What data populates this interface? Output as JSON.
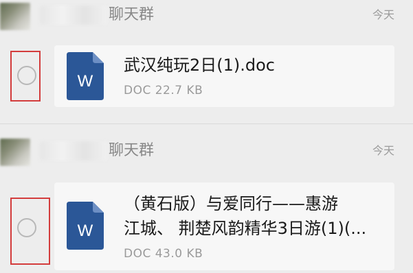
{
  "messages": [
    {
      "group_name": "聊天群",
      "time": "今天",
      "selected": false,
      "file": {
        "title_line1": "武汉纯玩2日(1).doc",
        "title_line2": "",
        "type": "DOC",
        "size": "22.7 KB",
        "meta": "DOC 22.7 KB",
        "icon": "word-doc-icon"
      }
    },
    {
      "group_name": "聊天群",
      "time": "今天",
      "selected": false,
      "file": {
        "title_line1": "（黄石版）与爱同行——惠游",
        "title_line2": "江城、 荆楚风韵精华3日游(1)(...",
        "type": "DOC",
        "size": "43.0 KB",
        "meta": "DOC 43.0 KB",
        "icon": "word-doc-icon"
      }
    }
  ],
  "colors": {
    "background": "#ededed",
    "card": "#f7f7f7",
    "word_blue": "#2b5797",
    "selection_box": "#d33c3c",
    "radio": "#b8b8b8"
  }
}
